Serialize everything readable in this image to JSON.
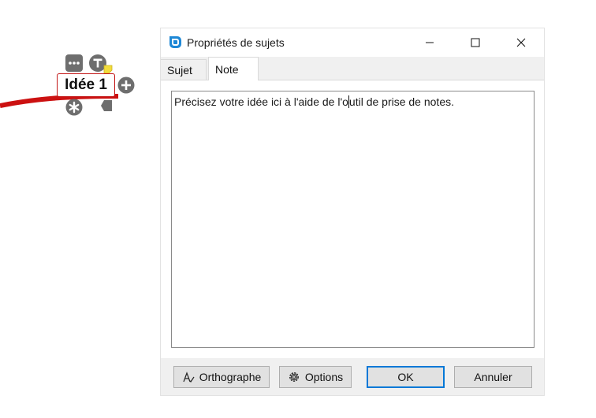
{
  "mindmap": {
    "topic_label": "Idée 1",
    "branch_color": "#cc1111",
    "icons": [
      "more-options-icon",
      "text-icon",
      "add-child-icon",
      "asterisk-icon",
      "collapse-arrow-icon"
    ]
  },
  "dialog": {
    "title": "Propriétés de sujets",
    "tabs": [
      {
        "label": "Sujet",
        "active": false
      },
      {
        "label": "Note",
        "active": true
      }
    ],
    "note_text_before_caret": "Précisez votre idée ici à l'aide de l'o",
    "note_text_after_caret": "util de prise de notes.",
    "buttons": {
      "spell": "Orthographe",
      "options": "Options",
      "ok": "OK",
      "cancel": "Annuler"
    },
    "accent_color": "#0078d7"
  }
}
